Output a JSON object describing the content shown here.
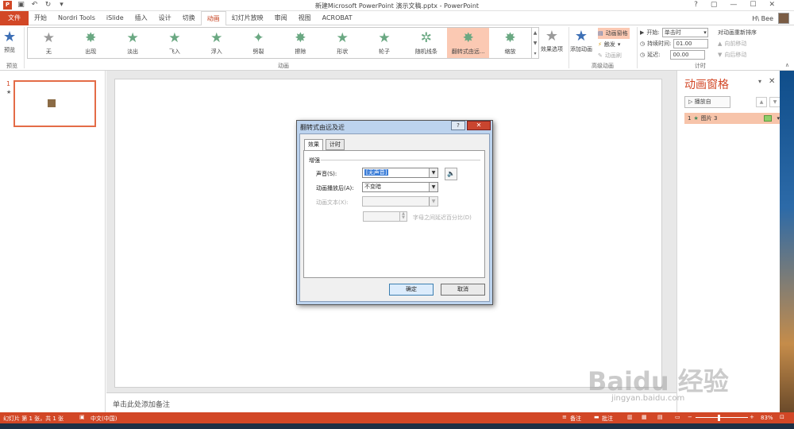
{
  "title_bar": {
    "title": "新建Microsoft PowerPoint 演示文稿.pptx - PowerPoint",
    "help": "?",
    "window_controls": [
      "▢",
      "—",
      "☐",
      "✕"
    ]
  },
  "tabs": [
    "文件",
    "开始",
    "Nordri Tools",
    "iSlide",
    "插入",
    "设计",
    "切换",
    "动画",
    "幻灯片放映",
    "审阅",
    "视图",
    "ACROBAT"
  ],
  "user": {
    "name": "H\\ Bee"
  },
  "ribbon": {
    "preview": {
      "label": "预览",
      "group": "预览"
    },
    "animations": [
      {
        "label": "无",
        "icon": "none-star-icon"
      },
      {
        "label": "出现",
        "icon": "appear-icon"
      },
      {
        "label": "淡出",
        "icon": "fade-icon"
      },
      {
        "label": "飞入",
        "icon": "fly-in-icon"
      },
      {
        "label": "浮入",
        "icon": "float-in-icon"
      },
      {
        "label": "劈裂",
        "icon": "split-icon"
      },
      {
        "label": "擦除",
        "icon": "wipe-icon"
      },
      {
        "label": "形状",
        "icon": "shape-icon"
      },
      {
        "label": "轮子",
        "icon": "wheel-icon"
      },
      {
        "label": "随机线条",
        "icon": "random-bars-icon"
      },
      {
        "label": "翻转式由远...",
        "icon": "grow-turn-icon"
      },
      {
        "label": "缩放",
        "icon": "zoom-icon"
      }
    ],
    "animation_group": "动画",
    "effect_options": "效果选项",
    "add_animation": "添加动画",
    "anim_pane_btn": "动画窗格",
    "trigger": "触发",
    "anim_painter": "动画刷",
    "advanced_group": "高级动画",
    "start_label": "开始:",
    "start_value": "单击时",
    "duration_label": "持续时间:",
    "duration_value": "01.00",
    "delay_label": "延迟:",
    "delay_value": "00.00",
    "reorder_title": "对动画重新排序",
    "move_earlier": "向前移动",
    "move_later": "向后移动",
    "timing_group": "计时"
  },
  "thumbnail": {
    "number": "1",
    "marker": "★"
  },
  "notes_placeholder": "单击此处添加备注",
  "anim_pane": {
    "title": "动画窗格",
    "play_button": "播放自",
    "item": {
      "index": "1",
      "label": "图片 3"
    }
  },
  "dialog": {
    "title": "翻转式由远及近",
    "tabs": [
      "效果",
      "计时"
    ],
    "group": "增强",
    "sound_label": "声音(S):",
    "sound_value": "[无声音]",
    "after_label": "动画播放后(A):",
    "after_value": "不变暗",
    "text_label": "动画文本(X):",
    "text_value": "",
    "letter_delay_label": "字母之间延迟百分比(D)",
    "ok": "确定",
    "cancel": "取消"
  },
  "status_bar": {
    "slide_info": "幻灯片 第 1 张，共 1 张",
    "language": "中文(中国)",
    "notes": "备注",
    "comments": "批注",
    "zoom": "83%"
  },
  "watermark": {
    "brand": "Baidu 经验",
    "url": "jingyan.baidu.com"
  },
  "colors": {
    "accent": "#d24726",
    "selected_anim": "#fbc9b3",
    "anim_star": "#6aa882"
  }
}
